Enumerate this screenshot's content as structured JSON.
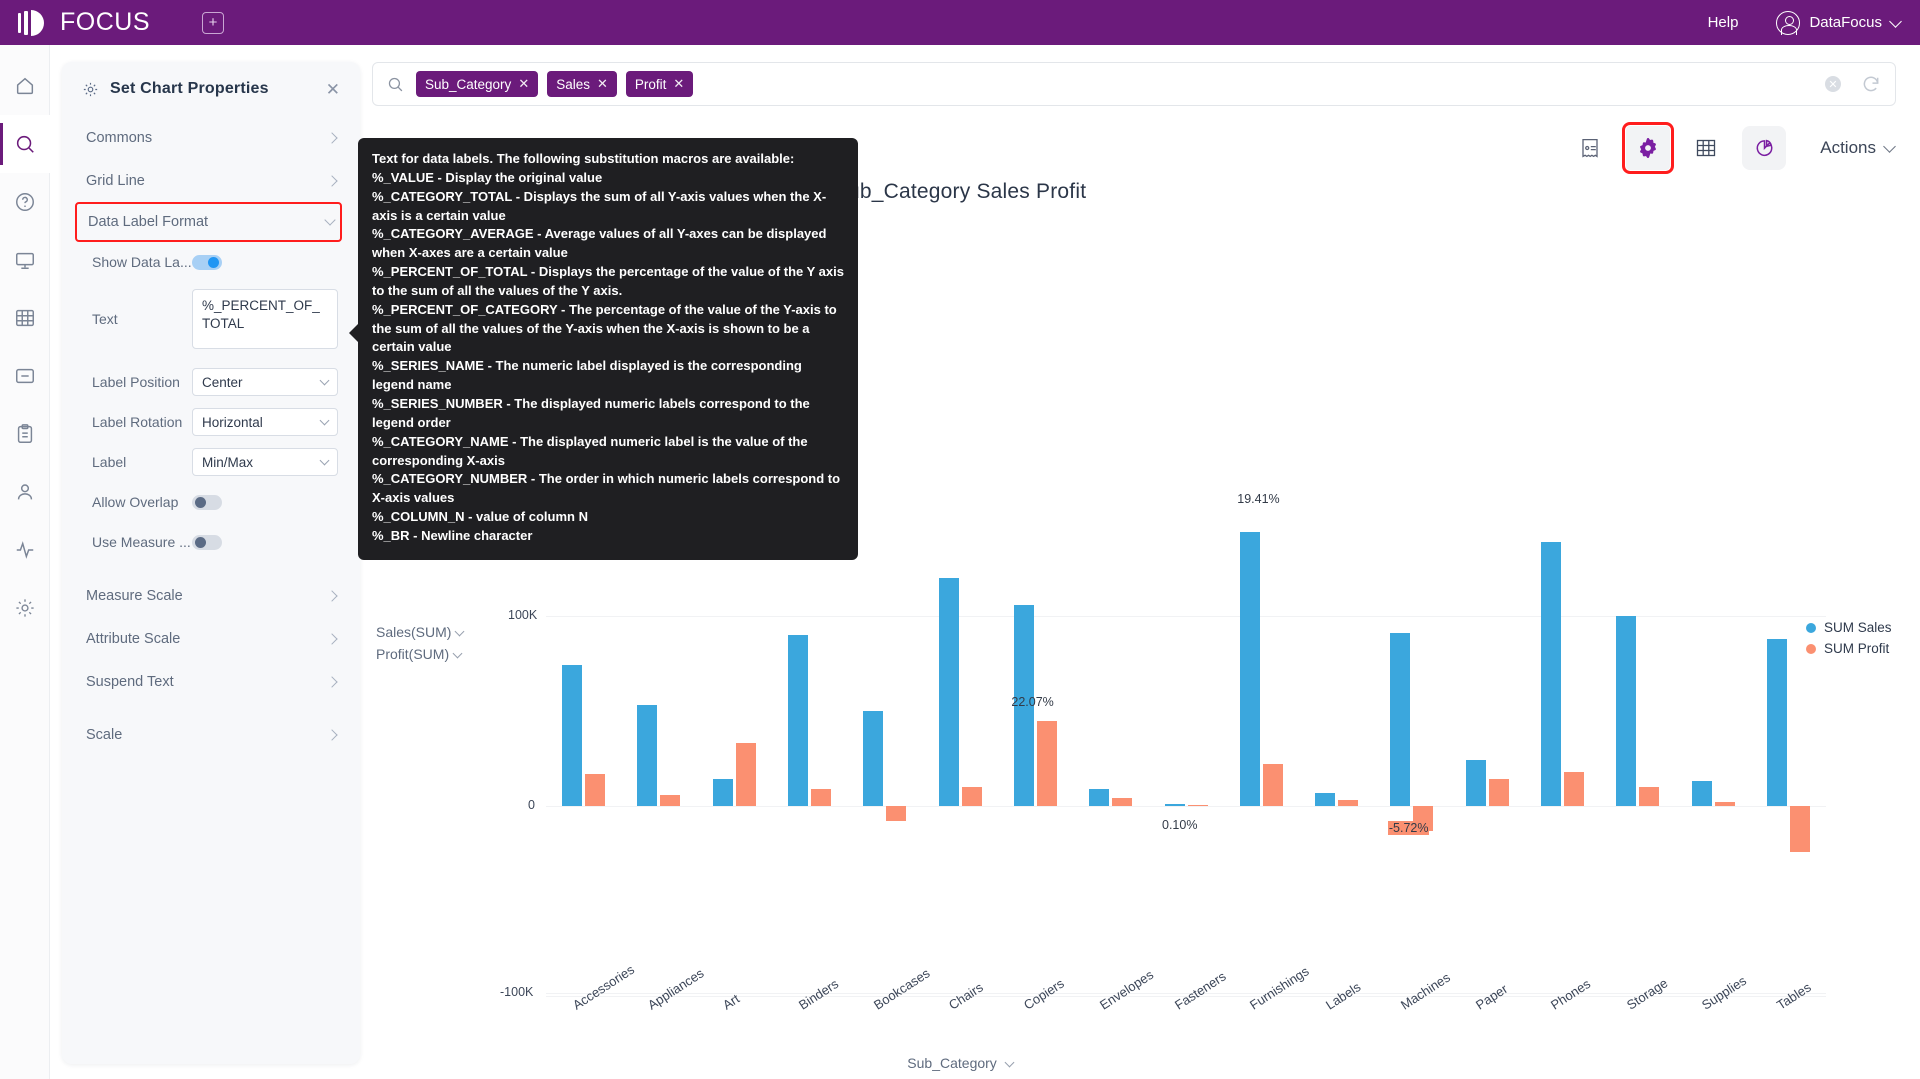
{
  "topbar": {
    "logo_text": "FOCUS",
    "add_tab_icon": "plus-square-icon",
    "help_label": "Help",
    "user_label": "DataFocus"
  },
  "rail": {
    "items": [
      {
        "name": "home-icon"
      },
      {
        "name": "search-icon"
      },
      {
        "name": "help-circle-icon"
      },
      {
        "name": "presentation-icon"
      },
      {
        "name": "table-icon"
      },
      {
        "name": "minus-box-icon"
      },
      {
        "name": "clipboard-icon"
      },
      {
        "name": "user-icon"
      },
      {
        "name": "activity-icon"
      },
      {
        "name": "settings-icon"
      }
    ]
  },
  "panel": {
    "title": "Set Chart Properties",
    "gear_icon": "gear-icon",
    "close_icon": "close-icon",
    "sections": [
      {
        "label": "Commons"
      },
      {
        "label": "Grid Line"
      },
      {
        "label": "Data Label Format"
      },
      {
        "label": "Measure Scale"
      },
      {
        "label": "Attribute Scale"
      },
      {
        "label": "Suspend Text"
      },
      {
        "label": "Scale"
      }
    ],
    "fields": {
      "show_data_label": {
        "label": "Show Data La...",
        "value": "on"
      },
      "text": {
        "label": "Text",
        "value": "%_PERCENT_OF_TOTAL"
      },
      "label_position": {
        "label": "Label Position",
        "value": "Center"
      },
      "label_rotation": {
        "label": "Label Rotation",
        "value": "Horizontal"
      },
      "label": {
        "label": "Label",
        "value": "Min/Max"
      },
      "allow_overlap": {
        "label": "Allow Overlap",
        "value": "off"
      },
      "use_measure": {
        "label": "Use Measure ...",
        "value": "off"
      }
    }
  },
  "tooltip": {
    "lines": [
      "Text for data labels. The following substitution macros are available:",
      "%_VALUE - Display the original value",
      "%_CATEGORY_TOTAL - Displays the sum of all Y-axis values when the X-axis is a certain value",
      "%_CATEGORY_AVERAGE - Average values of all Y-axes can be displayed when X-axes are a certain value",
      "%_PERCENT_OF_TOTAL - Displays the percentage of the value of the Y axis to the sum of all the values of the Y axis.",
      "%_PERCENT_OF_CATEGORY - The percentage of the value of the Y-axis to the sum of all the values of the Y-axis when the X-axis is shown to be a certain value",
      "%_SERIES_NAME - The numeric label displayed is the corresponding legend name",
      "%_SERIES_NUMBER - The displayed numeric labels correspond to the legend order",
      "%_CATEGORY_NAME - The displayed numeric label is the value of the corresponding X-axis",
      "%_CATEGORY_NUMBER - The order in which numeric labels correspond to X-axis values",
      "%_COLUMN_N - value of column N",
      "%_BR - Newline character"
    ]
  },
  "search": {
    "search_icon": "search-icon",
    "chips": [
      "Sub_Category",
      "Sales",
      "Profit"
    ],
    "placeholder": "",
    "value": "",
    "clear_icon": "clear-circle-icon",
    "refresh_icon": "refresh-icon"
  },
  "chart_tools": {
    "items": [
      {
        "name": "receipt-icon",
        "selected": false,
        "highlighted": false
      },
      {
        "name": "gear-icon",
        "selected": true,
        "highlighted": true
      },
      {
        "name": "table-grid-icon",
        "selected": false,
        "highlighted": false
      },
      {
        "name": "pie-chart-icon",
        "selected": true,
        "highlighted": false
      }
    ],
    "actions_label": "Actions"
  },
  "measure_legend": [
    "Sales(SUM)",
    "Profit(SUM)"
  ],
  "chart_data": {
    "type": "bar",
    "title": "Sub_Category Sales Profit",
    "xlabel": "Sub_Category",
    "ylabel": "",
    "ylim": [
      -100000,
      150000
    ],
    "yticks": [
      {
        "label": "100K",
        "value": 100000
      },
      {
        "label": "0",
        "value": 0
      },
      {
        "label": "-100K",
        "value": -100000
      }
    ],
    "grid": true,
    "legend_position": "right",
    "legend": [
      "SUM Sales",
      "SUM Profit"
    ],
    "colors": {
      "sales": "#3ba7dd",
      "profit": "#fb9071"
    },
    "categories": [
      "Accessories",
      "Appliances",
      "Art",
      "Binders",
      "Bookcases",
      "Chairs",
      "Copiers",
      "Envelopes",
      "Fasteners",
      "Furnishings",
      "Labels",
      "Machines",
      "Paper",
      "Phones",
      "Storage",
      "Supplies",
      "Tables"
    ],
    "series": [
      {
        "name": "SUM Sales",
        "values": [
          74000,
          53000,
          14000,
          90000,
          50000,
          120000,
          106000,
          9000,
          1200,
          144000,
          7000,
          91000,
          24000,
          139000,
          100000,
          13000,
          88000
        ]
      },
      {
        "name": "SUM Profit",
        "values": [
          17000,
          6000,
          33000,
          9000,
          -8000,
          10000,
          45000,
          4000,
          300,
          22000,
          3000,
          -13000,
          14000,
          18000,
          10000,
          2000,
          -24000
        ]
      }
    ],
    "data_labels": [
      {
        "category": "Copiers",
        "text": "22.07%",
        "highlighted": false
      },
      {
        "category": "Fasteners",
        "text": "0.10%",
        "highlighted": false
      },
      {
        "category": "Furnishings",
        "text": "19.41%",
        "highlighted": false
      },
      {
        "category": "Machines",
        "text": "-5.72%",
        "highlighted": true
      }
    ]
  }
}
